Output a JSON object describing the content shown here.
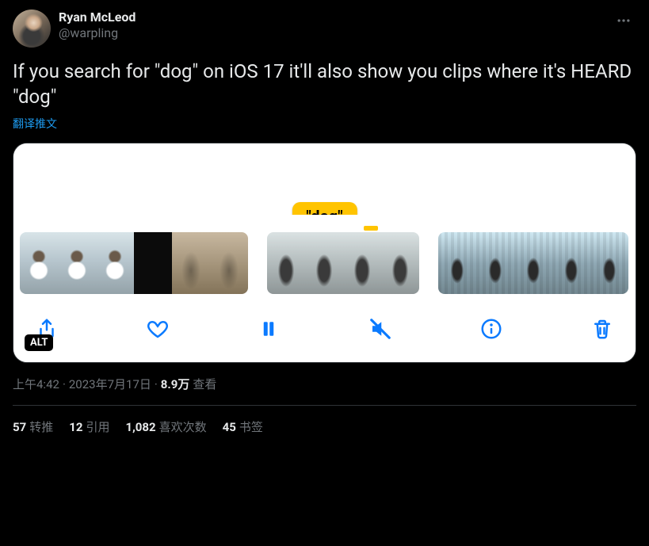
{
  "author": {
    "name": "Ryan McLeod",
    "handle": "@warpling"
  },
  "tweet_text": "If you search for \"dog\" on iOS 17 it'll also show you clips where it's HEARD \"dog\"",
  "translate_label": "翻译推文",
  "media": {
    "caption_bubble": "\"dog\"",
    "alt_badge": "ALT"
  },
  "timestamp": {
    "time": "上午4:42",
    "date": "2023年7月17日",
    "views_count": "8.9万",
    "views_label": "查看"
  },
  "stats": {
    "retweets": {
      "count": "57",
      "label": "转推"
    },
    "quotes": {
      "count": "12",
      "label": "引用"
    },
    "likes": {
      "count": "1,082",
      "label": "喜欢次数"
    },
    "bookmarks": {
      "count": "45",
      "label": "书签"
    }
  }
}
